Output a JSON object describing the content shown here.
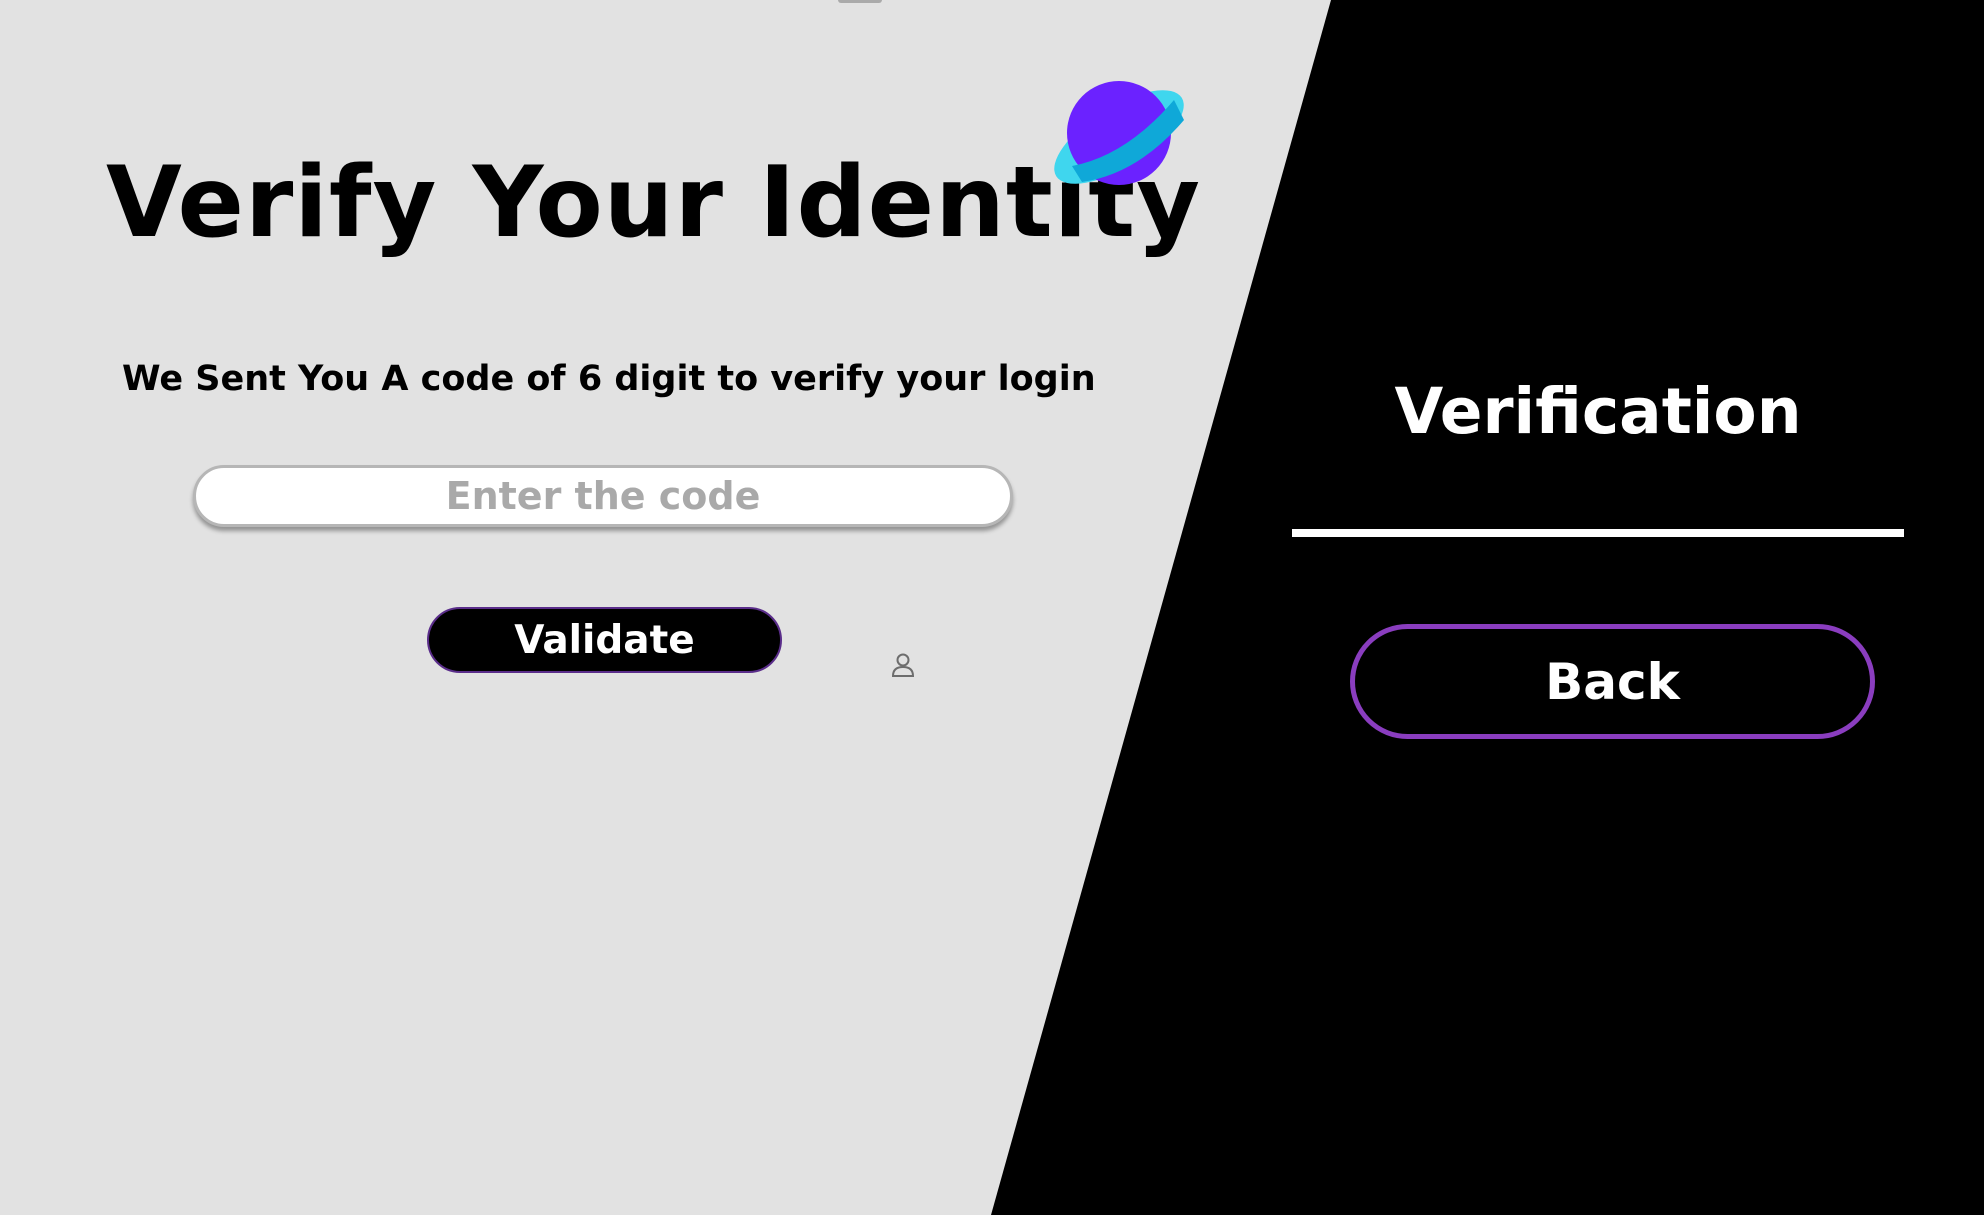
{
  "left_panel": {
    "title": "Verify Your Identity",
    "logo_icon": "planet-icon",
    "subtitle": "We Sent You A code of 6 digit to verify your login",
    "code_input": {
      "value": "",
      "placeholder": "Enter the code"
    },
    "validate_label": "Validate",
    "user_icon": "user-icon"
  },
  "right_panel": {
    "title": "Verification",
    "back_label": "Back"
  },
  "colors": {
    "background_light": "#e2e2e2",
    "background_dark": "#000000",
    "accent_purple": "#8a3dbf",
    "planet_purple": "#6b22ff",
    "planet_ring": "#3fd6ee"
  }
}
